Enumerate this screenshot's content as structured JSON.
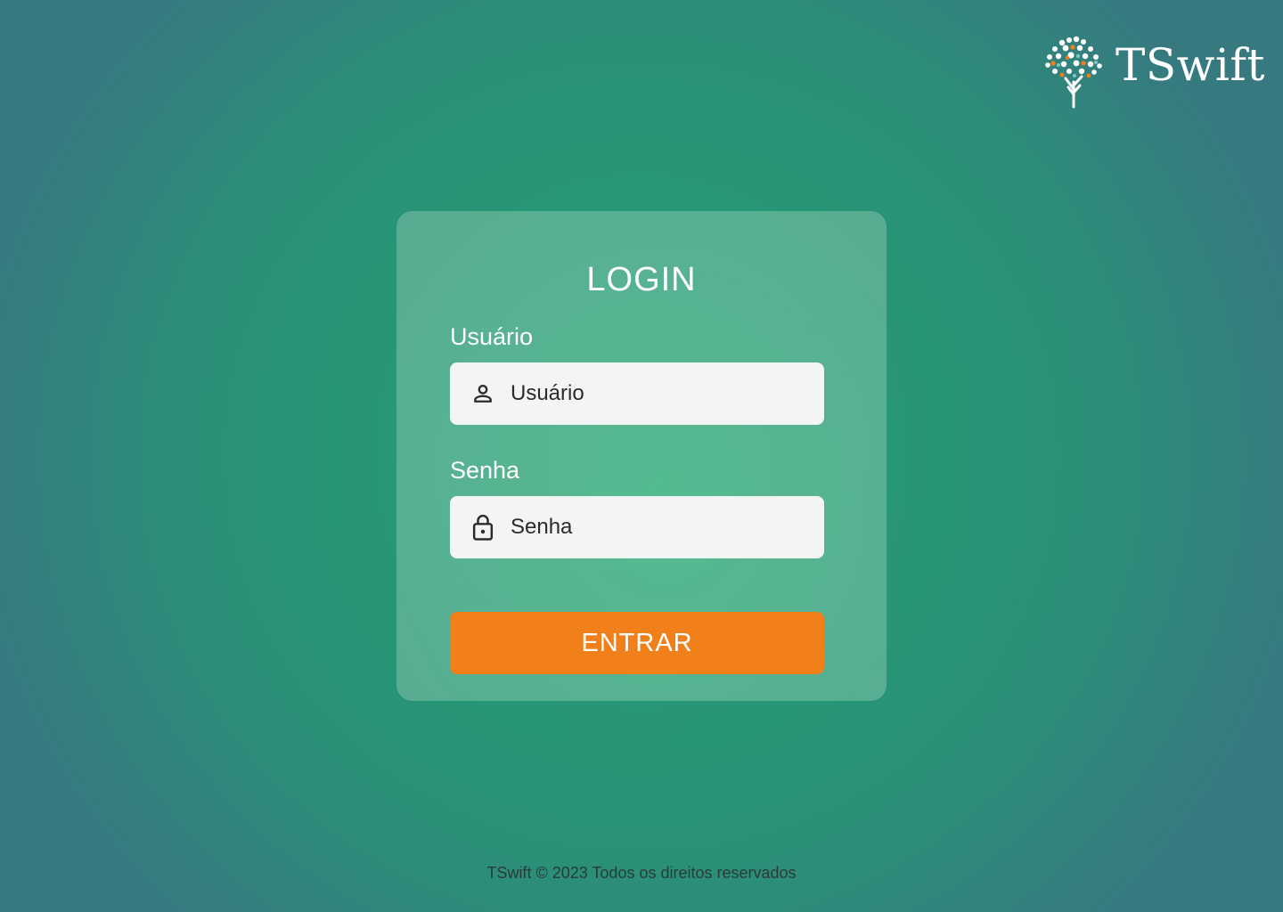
{
  "brand": {
    "name": "TSwift",
    "logo_icon": "tree-logo-icon",
    "accent_color": "#f2801a"
  },
  "login": {
    "title": "LOGIN",
    "username_label": "Usuário",
    "username_placeholder": "Usuário",
    "username_icon": "person-icon",
    "password_label": "Senha",
    "password_placeholder": "Senha",
    "password_icon": "lock-icon",
    "submit_label": "ENTRAR"
  },
  "footer": {
    "text": "TSwift © 2023 Todos os direitos reservados"
  }
}
